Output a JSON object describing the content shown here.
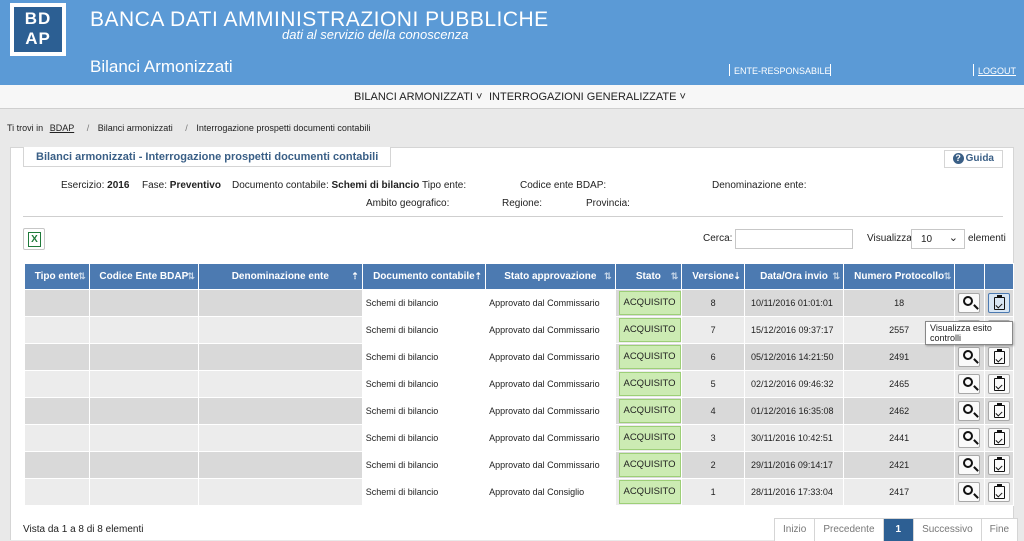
{
  "header": {
    "logo_top": "BD",
    "logo_bottom": "AP",
    "brand_title": "BANCA DATI AMMINISTRAZIONI PUBBLICHE",
    "brand_subtitle": "dati al servizio della conoscenza",
    "app_title": "Bilanci Armonizzati",
    "ente_link": "ENTE-RESPONSABILE",
    "logout": "LOGOUT"
  },
  "menu": [
    {
      "label": "BILANCI ARMONIZZATI ˅"
    },
    {
      "label": "INTERROGAZIONI GENERALIZZATE ˅"
    }
  ],
  "breadcrumb": {
    "prefix": "Ti trovi in",
    "items": [
      "BDAP",
      "Bilanci armonizzati",
      "Interrogazione prospetti documenti contabili"
    ]
  },
  "panel": {
    "title": "Bilanci armonizzati - Interrogazione prospetti documenti contabili",
    "guide": "Guida"
  },
  "filters": {
    "esercizio_label": "Esercizio:",
    "esercizio_value": "2016",
    "fase_label": "Fase:",
    "fase_value": "Preventivo",
    "documento_label": "Documento contabile:",
    "documento_value": "Schemi di bilancio",
    "tipo_ente_label": "Tipo ente:",
    "codice_label": "Codice ente BDAP:",
    "denominazione_label": "Denominazione ente:",
    "ambito_label": "Ambito geografico:",
    "regione_label": "Regione:",
    "provincia_label": "Provincia:"
  },
  "controls": {
    "search_label": "Cerca:",
    "search_value": "",
    "show_label": "Visualizza",
    "page_size": "10",
    "elements_label": "elementi"
  },
  "table": {
    "columns": [
      "Tipo ente",
      "Codice Ente BDAP",
      "Denominazione ente",
      "Documento contabile",
      "Stato approvazione",
      "Stato",
      "Versione",
      "Data/Ora invio",
      "Numero Protocollo"
    ],
    "rows": [
      {
        "tipo": "",
        "codice": "",
        "denominazione": "",
        "documento": "Schemi di bilancio",
        "approvazione": "Approvato dal Commissario",
        "stato": "ACQUISITO",
        "versione": "8",
        "data": "10/11/2016 01:01:01",
        "protocollo": "18"
      },
      {
        "tipo": "",
        "codice": "",
        "denominazione": "",
        "documento": "Schemi di bilancio",
        "approvazione": "Approvato dal Commissario",
        "stato": "ACQUISITO",
        "versione": "7",
        "data": "15/12/2016 09:37:17",
        "protocollo": "2557"
      },
      {
        "tipo": "",
        "codice": "",
        "denominazione": "",
        "documento": "Schemi di bilancio",
        "approvazione": "Approvato dal Commissario",
        "stato": "ACQUISITO",
        "versione": "6",
        "data": "05/12/2016 14:21:50",
        "protocollo": "2491"
      },
      {
        "tipo": "",
        "codice": "",
        "denominazione": "",
        "documento": "Schemi di bilancio",
        "approvazione": "Approvato dal Commissario",
        "stato": "ACQUISITO",
        "versione": "5",
        "data": "02/12/2016 09:46:32",
        "protocollo": "2465"
      },
      {
        "tipo": "",
        "codice": "",
        "denominazione": "",
        "documento": "Schemi di bilancio",
        "approvazione": "Approvato dal Commissario",
        "stato": "ACQUISITO",
        "versione": "4",
        "data": "01/12/2016 16:35:08",
        "protocollo": "2462"
      },
      {
        "tipo": "",
        "codice": "",
        "denominazione": "",
        "documento": "Schemi di bilancio",
        "approvazione": "Approvato dal Commissario",
        "stato": "ACQUISITO",
        "versione": "3",
        "data": "30/11/2016 10:42:51",
        "protocollo": "2441"
      },
      {
        "tipo": "",
        "codice": "",
        "denominazione": "",
        "documento": "Schemi di bilancio",
        "approvazione": "Approvato dal Commissario",
        "stato": "ACQUISITO",
        "versione": "2",
        "data": "29/11/2016 09:14:17",
        "protocollo": "2421"
      },
      {
        "tipo": "",
        "codice": "",
        "denominazione": "",
        "documento": "Schemi di bilancio",
        "approvazione": "Approvato dal Consiglio",
        "stato": "ACQUISITO",
        "versione": "1",
        "data": "28/11/2016 17:33:04",
        "protocollo": "2417"
      }
    ]
  },
  "tooltip": "Visualizza esito controlli",
  "footer": {
    "info": "Vista da 1 a 8 di 8 elementi",
    "pager": [
      "Inizio",
      "Precedente",
      "1",
      "Successivo",
      "Fine"
    ]
  },
  "colors": {
    "header_bg": "#5b9ad6",
    "table_header": "#4c7ab1",
    "status_bg": "#ccebb3",
    "pager_active": "#2d5f93"
  }
}
